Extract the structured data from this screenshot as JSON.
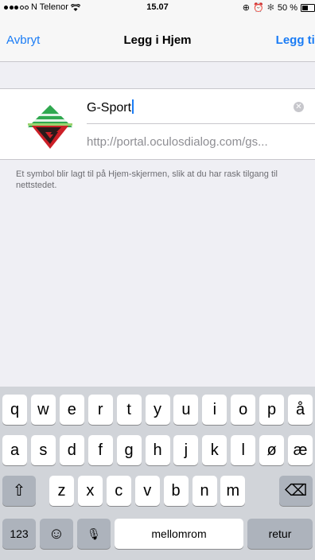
{
  "status_bar": {
    "carrier": "N Telenor",
    "time": "15.07",
    "battery": "50 %",
    "battery_level": 0.5
  },
  "nav": {
    "cancel": "Avbryt",
    "title": "Legg i Hjem",
    "add": "Legg til"
  },
  "form": {
    "name_value": "G-Sport",
    "url": "http://portal.oculosdialog.com/gs...",
    "clear_symbol": "✕"
  },
  "info": "Et symbol blir lagt til på Hjem-skjermen, slik at du har rask tilgang til nettstedet.",
  "keyboard": {
    "row1": [
      "q",
      "w",
      "e",
      "r",
      "t",
      "y",
      "u",
      "i",
      "o",
      "p",
      "å"
    ],
    "row2": [
      "a",
      "s",
      "d",
      "f",
      "g",
      "h",
      "j",
      "k",
      "l",
      "ø",
      "æ"
    ],
    "row3": [
      "z",
      "x",
      "c",
      "v",
      "b",
      "n",
      "m"
    ],
    "shift_symbol": "⇧",
    "delete_symbol": "⌫",
    "numbers": "123",
    "emoji_symbol": "☺",
    "mic_symbol": "🎙",
    "space": "mellomrom",
    "return": "retur"
  },
  "colors": {
    "accent": "#1a7cf5",
    "icon_green": "#2fa84f",
    "icon_red": "#cc1f27"
  }
}
